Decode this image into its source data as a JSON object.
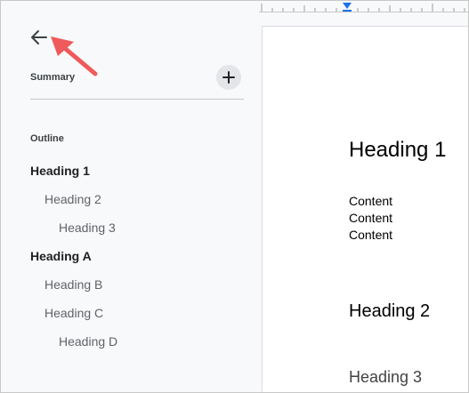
{
  "sidebar": {
    "back_icon": "arrow-left-icon",
    "summary_label": "Summary",
    "add_icon": "plus-icon",
    "outline_label": "Outline",
    "outline_items": [
      {
        "label": "Heading 1",
        "level": 1
      },
      {
        "label": "Heading 2",
        "level": 2
      },
      {
        "label": "Heading 3",
        "level": 3
      },
      {
        "label": "Heading A",
        "level": 1
      },
      {
        "label": "Heading B",
        "level": 2
      },
      {
        "label": "Heading C",
        "level": 2
      },
      {
        "label": "Heading D",
        "level": 3
      }
    ]
  },
  "document": {
    "heading1": "Heading 1",
    "content_lines": [
      "Content",
      "Content",
      "Content"
    ],
    "heading2": "Heading 2",
    "heading3": "Heading 3"
  },
  "colors": {
    "annotation_arrow": "#ef5a5a",
    "ruler_marker": "#1a73e8",
    "sidebar_bg": "#f8f9fa",
    "page_bg": "#ffffff"
  }
}
